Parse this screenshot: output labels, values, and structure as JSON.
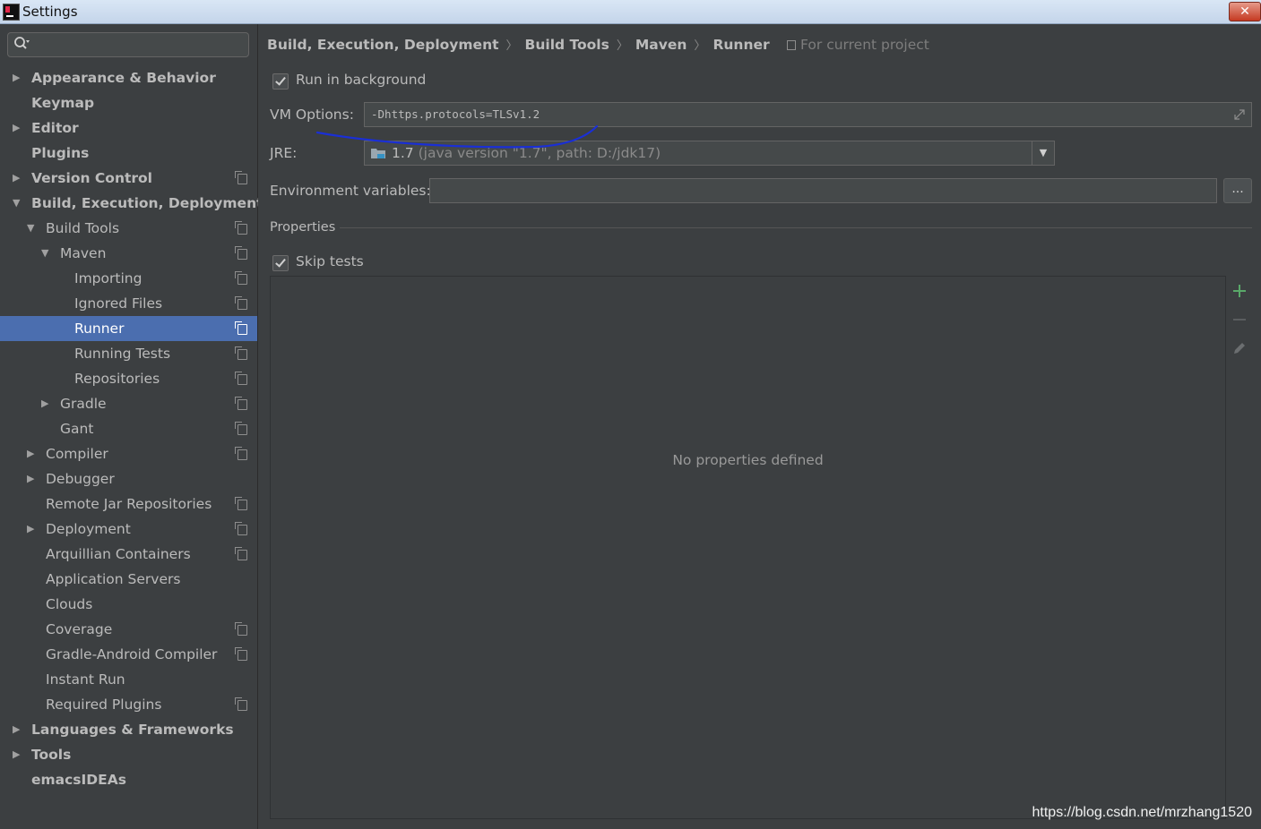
{
  "window": {
    "title": "Settings",
    "close_label": "✕"
  },
  "sidebar": {
    "search": {
      "value": "",
      "placeholder": ""
    },
    "items": [
      {
        "label": "Appearance & Behavior",
        "level": 0,
        "arrow": "right",
        "bold": true,
        "project": false,
        "selected": false
      },
      {
        "label": "Keymap",
        "level": 0,
        "arrow": "none",
        "bold": true,
        "project": false,
        "selected": false
      },
      {
        "label": "Editor",
        "level": 0,
        "arrow": "right",
        "bold": true,
        "project": false,
        "selected": false
      },
      {
        "label": "Plugins",
        "level": 0,
        "arrow": "none",
        "bold": true,
        "project": false,
        "selected": false
      },
      {
        "label": "Version Control",
        "level": 0,
        "arrow": "right",
        "bold": true,
        "project": true,
        "selected": false
      },
      {
        "label": "Build, Execution, Deployment",
        "level": 0,
        "arrow": "down",
        "bold": true,
        "project": false,
        "selected": false
      },
      {
        "label": "Build Tools",
        "level": 1,
        "arrow": "down",
        "bold": false,
        "project": true,
        "selected": false
      },
      {
        "label": "Maven",
        "level": 2,
        "arrow": "down",
        "bold": false,
        "project": true,
        "selected": false
      },
      {
        "label": "Importing",
        "level": 3,
        "arrow": "none",
        "bold": false,
        "project": true,
        "selected": false
      },
      {
        "label": "Ignored Files",
        "level": 3,
        "arrow": "none",
        "bold": false,
        "project": true,
        "selected": false
      },
      {
        "label": "Runner",
        "level": 3,
        "arrow": "none",
        "bold": false,
        "project": true,
        "selected": true
      },
      {
        "label": "Running Tests",
        "level": 3,
        "arrow": "none",
        "bold": false,
        "project": true,
        "selected": false
      },
      {
        "label": "Repositories",
        "level": 3,
        "arrow": "none",
        "bold": false,
        "project": true,
        "selected": false
      },
      {
        "label": "Gradle",
        "level": 2,
        "arrow": "right",
        "bold": false,
        "project": true,
        "selected": false
      },
      {
        "label": "Gant",
        "level": 2,
        "arrow": "none",
        "bold": false,
        "project": true,
        "selected": false
      },
      {
        "label": "Compiler",
        "level": 1,
        "arrow": "right",
        "bold": false,
        "project": true,
        "selected": false
      },
      {
        "label": "Debugger",
        "level": 1,
        "arrow": "right",
        "bold": false,
        "project": false,
        "selected": false
      },
      {
        "label": "Remote Jar Repositories",
        "level": 1,
        "arrow": "none",
        "bold": false,
        "project": true,
        "selected": false
      },
      {
        "label": "Deployment",
        "level": 1,
        "arrow": "right",
        "bold": false,
        "project": true,
        "selected": false
      },
      {
        "label": "Arquillian Containers",
        "level": 1,
        "arrow": "none",
        "bold": false,
        "project": true,
        "selected": false
      },
      {
        "label": "Application Servers",
        "level": 1,
        "arrow": "none",
        "bold": false,
        "project": false,
        "selected": false
      },
      {
        "label": "Clouds",
        "level": 1,
        "arrow": "none",
        "bold": false,
        "project": false,
        "selected": false
      },
      {
        "label": "Coverage",
        "level": 1,
        "arrow": "none",
        "bold": false,
        "project": true,
        "selected": false
      },
      {
        "label": "Gradle-Android Compiler",
        "level": 1,
        "arrow": "none",
        "bold": false,
        "project": true,
        "selected": false
      },
      {
        "label": "Instant Run",
        "level": 1,
        "arrow": "none",
        "bold": false,
        "project": false,
        "selected": false
      },
      {
        "label": "Required Plugins",
        "level": 1,
        "arrow": "none",
        "bold": false,
        "project": true,
        "selected": false
      },
      {
        "label": "Languages & Frameworks",
        "level": 0,
        "arrow": "right",
        "bold": true,
        "project": false,
        "selected": false
      },
      {
        "label": "Tools",
        "level": 0,
        "arrow": "right",
        "bold": true,
        "project": false,
        "selected": false
      },
      {
        "label": "emacsIDEAs",
        "level": 0,
        "arrow": "none",
        "bold": true,
        "project": false,
        "selected": false
      }
    ]
  },
  "breadcrumb": {
    "parts": [
      "Build, Execution, Deployment",
      "Build Tools",
      "Maven",
      "Runner"
    ],
    "separator": "〉",
    "scope": "For current project"
  },
  "runner": {
    "run_in_background": {
      "label": "Run in background",
      "checked": true
    },
    "vm_options": {
      "label": "VM Options:",
      "value": "-Dhttps.protocols=TLSv1.2"
    },
    "jre": {
      "label": "JRE:",
      "version": "1.7",
      "detail": "(java version \"1.7\", path: D:/jdk17)"
    },
    "env_vars": {
      "label": "Environment variables:",
      "value": "",
      "button_label": "..."
    },
    "properties_title": "Properties",
    "skip_tests": {
      "label": "Skip tests",
      "checked": true
    },
    "properties_empty": "No properties defined"
  },
  "colors": {
    "background": "#3c3f41",
    "selection": "#4b6eaf",
    "text": "#bbbbbb",
    "add_icon": "#59a869",
    "annotation_stroke": "#1a2fd6"
  },
  "watermark": "https://blog.csdn.net/mrzhang1520"
}
